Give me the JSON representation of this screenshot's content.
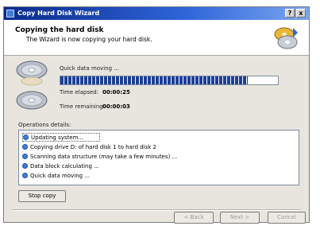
{
  "window": {
    "title": "Copy Hard Disk Wizard",
    "help_glyph": "?",
    "close_glyph": "x"
  },
  "header": {
    "title": "Copying the hard disk",
    "subtitle": "The Wizard is now copying your hard disk."
  },
  "progress": {
    "status": "Quick data moving ...",
    "fraction": 0.86,
    "elapsed_label": "Time elapsed:",
    "elapsed_value": "00:00:25",
    "remaining_label": "Time remaining:",
    "remaining_value": "00:00:03"
  },
  "operations": {
    "label": "Operations details:",
    "items": [
      "Updating system...",
      "Copying drive D: of hard disk 1 to hard disk 2",
      "Scanning data structure (may take a few minutes) ...",
      "Data block calculating ...",
      "Quick data moving ..."
    ]
  },
  "buttons": {
    "stop_copy": "Stop copy",
    "back": "< Back",
    "next": "Next >",
    "cancel": "Cancel"
  },
  "colors": {
    "titlebar": "#0a2a8c",
    "progress_fill": "#1d3f97",
    "op_icon": "#3f7fcf"
  }
}
